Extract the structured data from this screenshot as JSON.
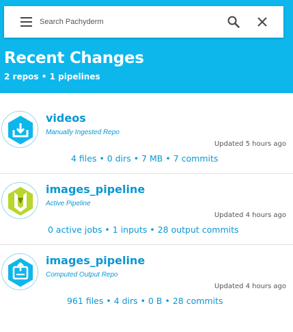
{
  "colors": {
    "header_bg": "#0db7ec",
    "accent": "#0a97d3",
    "pipeline_green": "#b8d62b",
    "text_muted": "#555555"
  },
  "search": {
    "placeholder": "Search Pachyderm",
    "icons": {
      "menu": "hamburger-menu-icon",
      "search": "search-icon",
      "close": "close-icon"
    }
  },
  "header": {
    "title": "Recent Changes",
    "subtitle": "2 repos • 1 pipelines"
  },
  "repos": [
    {
      "name": "videos",
      "type": "Manually Ingested Repo",
      "icon": "download-icon",
      "updated": "Updated 5 hours ago",
      "stats": "4 files • 0 dirs • 7 MB • 7 commits"
    },
    {
      "name": "images_pipeline",
      "type": "Active Pipeline",
      "icon": "pipeline-icon",
      "updated": "Updated 4 hours ago",
      "stats": "0 active jobs • 1 inputs • 28 output commits"
    },
    {
      "name": "images_pipeline",
      "type": "Computed Output Repo",
      "icon": "output-repo-icon",
      "updated": "Updated 4 hours ago",
      "stats": "961 files • 4 dirs • 0 B • 28 commits"
    }
  ]
}
